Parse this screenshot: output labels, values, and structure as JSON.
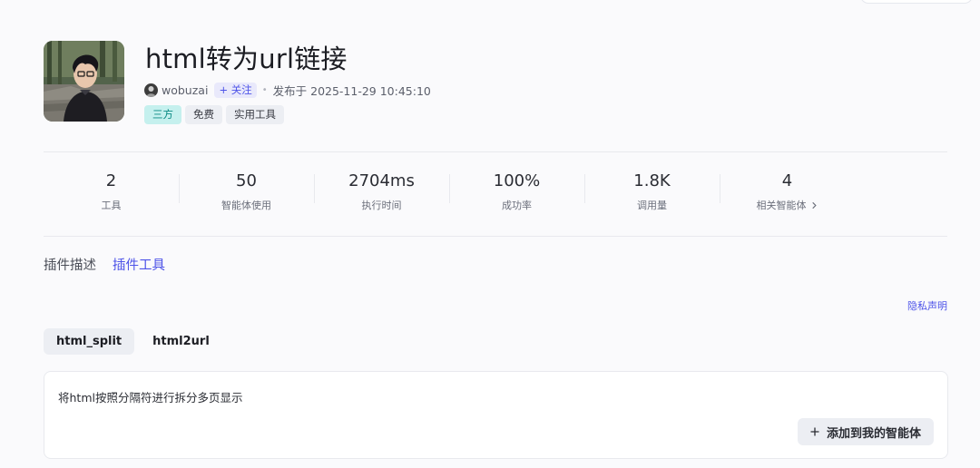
{
  "plugin": {
    "title": "html转为url链接",
    "author": "wobuzai",
    "follow_label": "+ 关注",
    "published": "发布于 2025-11-29 10:45:10",
    "tags": [
      "三方",
      "免费",
      "实用工具"
    ]
  },
  "stats": [
    {
      "value": "2",
      "label": "工具"
    },
    {
      "value": "50",
      "label": "智能体使用"
    },
    {
      "value": "2704ms",
      "label": "执行时间"
    },
    {
      "value": "100%",
      "label": "成功率"
    },
    {
      "value": "1.8K",
      "label": "调用量"
    },
    {
      "value": "4",
      "label": "相关智能体"
    }
  ],
  "tabs": {
    "description": "插件描述",
    "tools": "插件工具",
    "active": "tools"
  },
  "privacy_link": "隐私声明",
  "tools": [
    "html_split",
    "html2url"
  ],
  "active_tool": "html_split",
  "tool_card": {
    "description": "将html按照分隔符进行拆分多页显示",
    "add_button": "添加到我的智能体"
  },
  "icons": {
    "chevron": "chevron-right-icon",
    "plus": "plus-icon"
  },
  "colors": {
    "accent": "#4d53e8",
    "teal_tag_bg": "#c5f0ee",
    "teal_tag_text": "#0b8a84"
  }
}
